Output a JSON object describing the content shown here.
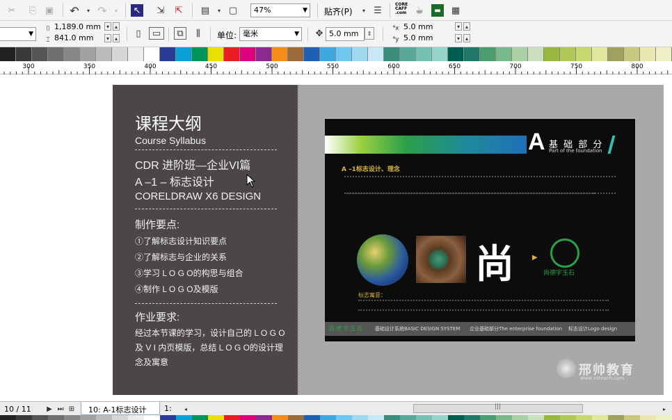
{
  "toolbar1": {
    "zoom": "47%",
    "snap_label": "贴齐(P)",
    "corel_label": "CORE\nCAFF\n.com"
  },
  "toolbar2": {
    "width": "1,189.0 mm",
    "height": "841.0 mm",
    "unit_label": "单位:",
    "unit_value": "毫米",
    "nudge": "5.0 mm",
    "dup_x": "5.0 mm",
    "dup_y": "5.0 mm"
  },
  "palette": [
    "#222222",
    "#3a3a3a",
    "#555555",
    "#6f6f6f",
    "#888888",
    "#a2a2a2",
    "#bcbcbc",
    "#d6d6d6",
    "#eeeeee",
    "#ffffff",
    "#2a3c96",
    "#0aa0d8",
    "#00935a",
    "#e8e000",
    "#e81e24",
    "#e0007a",
    "#8a2a8e",
    "#f48c18",
    "#9b6b3a",
    "#2060b0",
    "#40a8e0",
    "#70c8f0",
    "#a0d8f0",
    "#c8e8f8",
    "#3c8c7c",
    "#5aa898",
    "#78c0b0",
    "#98d4c8",
    "#005c50",
    "#207868",
    "#4c9c70",
    "#78b88a",
    "#a8d0a4",
    "#c8e0c0",
    "#98b840",
    "#b0c858",
    "#c8d870",
    "#e0e8a0",
    "#a0a060",
    "#c8c880",
    "#e8e8b0",
    "#f0f0c8"
  ],
  "ruler": [
    "300",
    "350",
    "400",
    "450",
    "500",
    "550",
    "600",
    "650",
    "700",
    "750",
    "800"
  ],
  "left_panel": {
    "title": "课程大纲",
    "subtitle": "Course Syllabus",
    "line1": "CDR 进阶班—企业VI篇",
    "line2": "A –1 – 标志设计",
    "line3": "CORELDRAW X6 DESIGN",
    "section1": "制作要点:",
    "points": [
      "①了解标志设计知识要点",
      "②了解标志与企业的关系",
      "③学习 L O G O的构思与组合",
      "④制作 L O G O及模版"
    ],
    "section2": "作业要求:",
    "homework": [
      "经过本节课的学习，设计自己的 L O G O",
      "及 V I 内页模版，总结 L O G O的设计理",
      "念及寓意"
    ]
  },
  "slide": {
    "header_A": "A",
    "header_cn": "基 础 部 分",
    "header_en": "Part of the foundation",
    "section_title": "A –1标志设计、理念",
    "logo_char": "尚",
    "logo_caption": "尚德宇玉石",
    "meaning_title": "标志寓意：",
    "footer_brand": "尚德宇玉石",
    "footer_items": [
      "基础设计系统BASIC DESIGN SYSTEM",
      "企业基础部分The enterprise foundation",
      "标志设计Logo design"
    ]
  },
  "watermark": {
    "name": "邢帅教育",
    "url": "www.xsteach.com"
  },
  "status": {
    "page_count": "10 / 11",
    "page_tab": "10: A-1标志设计",
    "next_tab": "1:"
  },
  "colors": {
    "panel": "#4c4747",
    "slide_bg": "#0c0c0c",
    "accent_blue": "#1e6fb8",
    "accent_green": "#2aa048",
    "gold": "#d9b13a"
  }
}
